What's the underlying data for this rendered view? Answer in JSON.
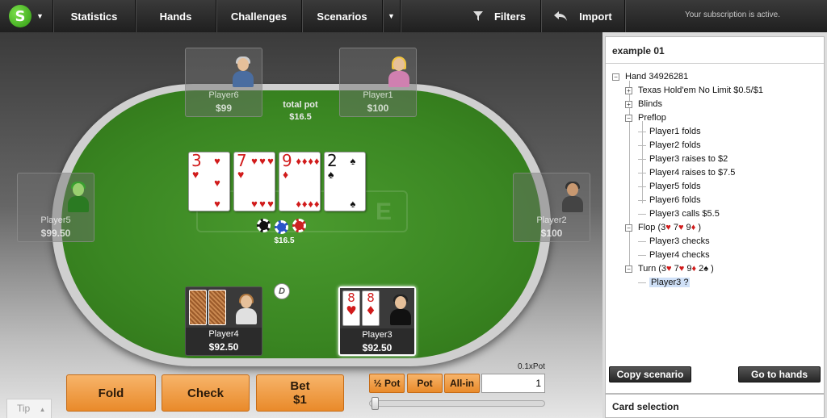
{
  "topbar": {
    "logo": "S",
    "nav": [
      "Statistics",
      "Hands",
      "Challenges",
      "Scenarios"
    ],
    "filters": "Filters",
    "import": "Import",
    "subscription": "Your subscription is active."
  },
  "table": {
    "total_pot_label": "total pot",
    "total_pot": "$16.5",
    "chips_total": "$16.5",
    "dealer": "D",
    "seats": {
      "player6": {
        "name": "Player6",
        "stack": "$99"
      },
      "player1": {
        "name": "Player1",
        "stack": "$100"
      },
      "player5": {
        "name": "Player5",
        "stack": "$99.50"
      },
      "player2": {
        "name": "Player2",
        "stack": "$100"
      },
      "player4": {
        "name": "Player4",
        "stack": "$92.50"
      },
      "player3": {
        "name": "Player3",
        "stack": "$92.50"
      }
    },
    "board": [
      {
        "rank": "3",
        "suit": "♥",
        "color": "red"
      },
      {
        "rank": "7",
        "suit": "♥",
        "color": "red"
      },
      {
        "rank": "9",
        "suit": "♦",
        "color": "red"
      },
      {
        "rank": "2",
        "suit": "♠",
        "color": "black"
      }
    ],
    "hero_cards": [
      {
        "rank": "8",
        "suit": "♥"
      },
      {
        "rank": "8",
        "suit": "♦"
      }
    ]
  },
  "actions": {
    "fold": "Fold",
    "check": "Check",
    "bet": "Bet",
    "bet_amount": "$1",
    "half_pot": "½ Pot",
    "pot": "Pot",
    "all_in": "All-in",
    "bet_value": "1",
    "pot_fraction": "0.1xPot",
    "slider_position": 0.0,
    "tip": "Tip"
  },
  "panel": {
    "title": "example 01",
    "tree": {
      "hand": "Hand 34926281",
      "game": "Texas Hold'em No Limit $0.5/$1",
      "blinds": "Blinds",
      "preflop": "Preflop",
      "preflop_actions": [
        "Player1 folds",
        "Player2 folds",
        "Player3 raises to $2",
        "Player4 raises to $7.5",
        "Player5 folds",
        "Player6 folds",
        "Player3 calls $5.5"
      ],
      "flop": "Flop (3♥ 7♥ 9♦ )",
      "flop_actions": [
        "Player3 checks",
        "Player4 checks"
      ],
      "turn": "Turn (3♥ 7♥ 9♦ 2♠ )",
      "turn_actions": [
        "Player3 ?"
      ]
    },
    "copy_scenario": "Copy scenario",
    "go_to_hands": "Go to hands",
    "card_selection": "Card selection"
  }
}
